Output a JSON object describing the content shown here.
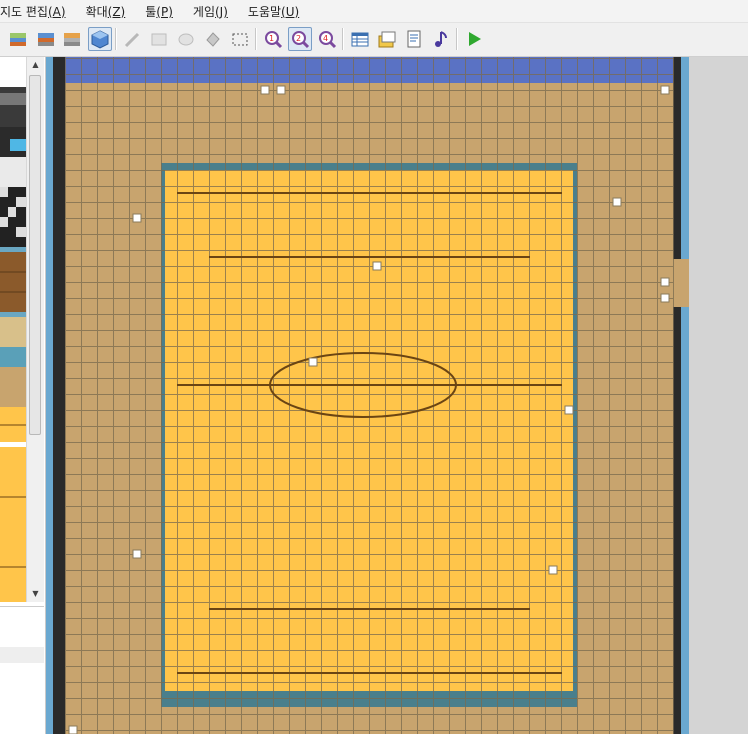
{
  "menu": [
    {
      "label": "지도 편집",
      "key": "(A)"
    },
    {
      "label": "확대",
      "key": "(Z)"
    },
    {
      "label": "툴",
      "key": "(P)"
    },
    {
      "label": "게임",
      "key": "(J)"
    },
    {
      "label": "도움말",
      "key": "(U)"
    }
  ],
  "toolbar": {
    "groups": [
      [
        "layer-1-icon",
        "layer-2-icon",
        "layer-3-icon",
        "event-layer-icon"
      ],
      [
        "pencil-icon",
        "rectangle-icon",
        "ellipse-icon",
        "fill-icon",
        "select-icon"
      ],
      [
        "zoom-1x-icon",
        "zoom-half-icon",
        "zoom-quarter-icon"
      ],
      [
        "database-icon",
        "material-icon",
        "script-icon",
        "sound-icon"
      ],
      [
        "playtest-icon"
      ]
    ],
    "pressed": [
      "event-layer-icon",
      "zoom-half-icon"
    ]
  },
  "colors": {
    "floor": "#c8a46e",
    "court": "#ffc54a",
    "court_border": "#4a7f8c",
    "wall_top": "#5a72c4",
    "water": "#6aa8d0",
    "dark_wall": "#2a2a2a",
    "grid": "#7a6b4f",
    "court_line": "#6b4513",
    "event_marker": "#ffffff"
  }
}
